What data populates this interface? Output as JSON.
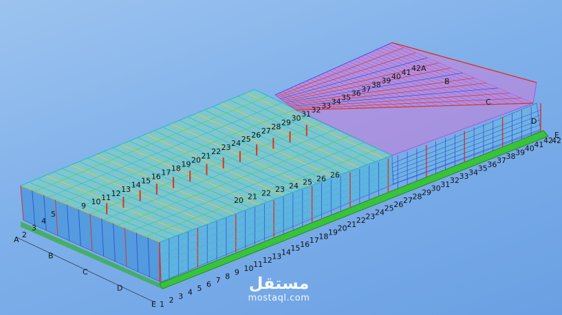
{
  "colors": {
    "background_top": "#9cc3ef",
    "background_bottom": "#6aa0e3",
    "slab": "#39c33a",
    "steel_magenta": "#d24bd8",
    "steel_cyan": "#27c3c8",
    "steel_yellow": "#e4d22a",
    "steel_red": "#e0301e",
    "steel_blue": "#2b54d6",
    "steel_green": "#4bd35b"
  },
  "front_grid_numbers": [
    "1",
    "2",
    "3",
    "4",
    "5",
    "6",
    "7",
    "8",
    "9",
    "10",
    "11",
    "12",
    "13",
    "14",
    "15",
    "16",
    "17",
    "18",
    "19",
    "20",
    "21",
    "22",
    "23",
    "24",
    "25",
    "26",
    "27",
    "28",
    "29",
    "30",
    "31",
    "32",
    "33",
    "34",
    "35",
    "36",
    "37",
    "38",
    "39",
    "40",
    "41",
    "42"
  ],
  "left_grid_letters": [
    "A",
    "B",
    "C",
    "D",
    "E"
  ],
  "left_grid_numbers": [
    "2",
    "3",
    "4",
    "5"
  ],
  "roof_grid_numbers": [
    "9",
    "10",
    "11",
    "12",
    "13",
    "14",
    "15",
    "16",
    "17",
    "18",
    "19",
    "20",
    "21",
    "22",
    "23",
    "24",
    "25",
    "26",
    "27",
    "28",
    "29",
    "30",
    "31",
    "32",
    "33",
    "34",
    "35",
    "36",
    "37",
    "38",
    "39",
    "40",
    "41",
    "42A"
  ],
  "right_grid_letters": [
    "B",
    "C",
    "D"
  ],
  "mid_grid_numbers": [
    "20",
    "21",
    "22",
    "23",
    "24",
    "25",
    "26",
    "26"
  ],
  "right_edge_labels": [
    "E",
    "42"
  ],
  "watermark": {
    "arabic": "مستقل",
    "latin": "mostaql.com"
  }
}
